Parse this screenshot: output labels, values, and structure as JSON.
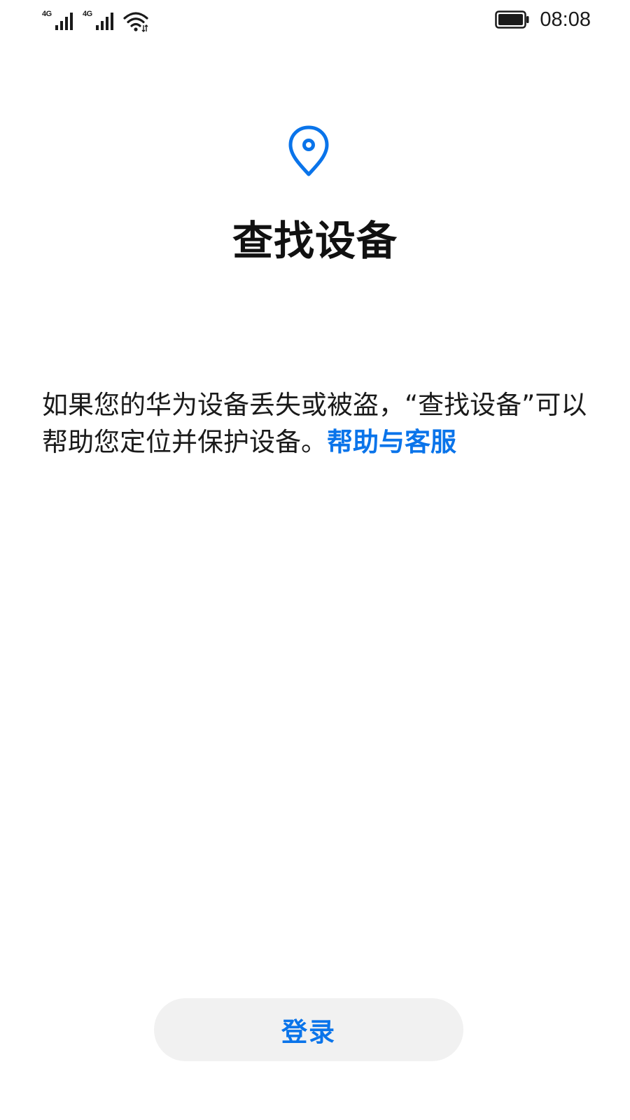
{
  "status_bar": {
    "sim1_network": "4G",
    "sim2_network": "4G",
    "time": "08:08",
    "icons": [
      "signal-icon",
      "signal-icon",
      "wifi-icon",
      "battery-icon"
    ]
  },
  "main": {
    "icon": "location-pin-icon",
    "title": "查找设备",
    "description": "如果您的华为设备丢失或被盗，“查找设备”可以帮助您定位并保护设备。",
    "help_link": "帮助与客服"
  },
  "footer": {
    "login_label": "登录"
  },
  "colors": {
    "accent": "#0a74ea",
    "button_bg": "#f1f1f1",
    "text": "#1a1a1a"
  }
}
